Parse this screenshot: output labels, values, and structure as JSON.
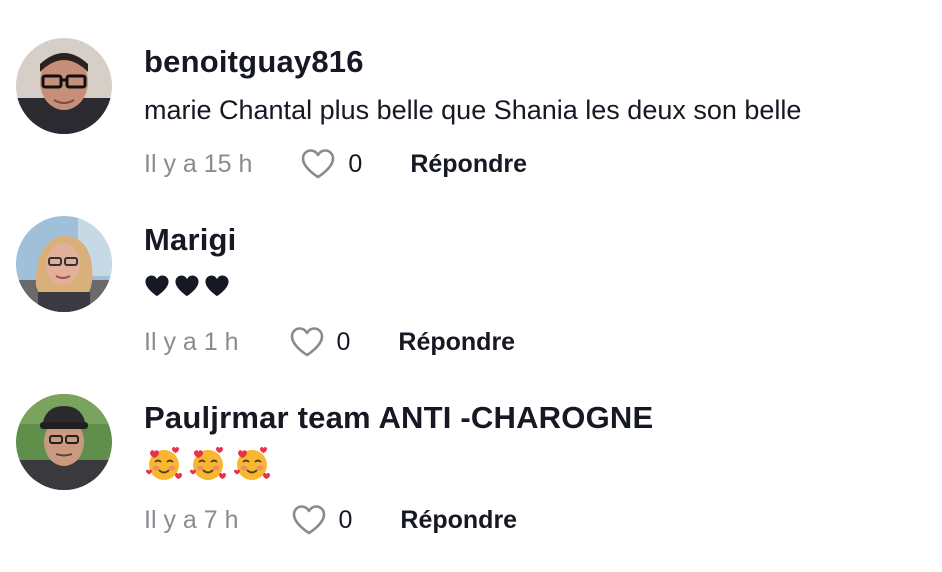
{
  "comments": [
    {
      "username": "benoitguay816",
      "text": "marie Chantal plus belle que Shania les deux son belle",
      "time": "Il y a 15 h",
      "likes": "0",
      "reply_label": "Répondre",
      "emoji_icons": []
    },
    {
      "username": "Marigi",
      "text": "",
      "time": "Il y a 1 h",
      "likes": "0",
      "reply_label": "Répondre",
      "emoji_icons": [
        "black-heart-icon",
        "black-heart-icon",
        "black-heart-icon"
      ]
    },
    {
      "username": "Pauljrmar team ANTI -CHAROGNE",
      "text": "",
      "time": "Il y a 7 h",
      "likes": "0",
      "reply_label": "Répondre",
      "emoji_icons": [
        "smiling-face-with-hearts-icon",
        "smiling-face-with-hearts-icon",
        "smiling-face-with-hearts-icon"
      ]
    }
  ],
  "colors": {
    "text_primary": "#161823",
    "text_secondary": "#8a8b91",
    "like_outline": "#8a8b91"
  }
}
